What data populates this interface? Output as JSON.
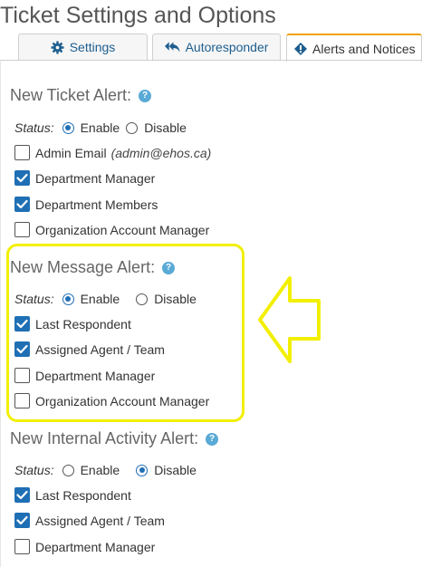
{
  "page_title": "Ticket Settings and Options",
  "colors": {
    "accent": "#1f6fb5",
    "highlight": "#f2ef00",
    "tab_active": "#f0a200"
  },
  "tabs": [
    {
      "label": "Settings",
      "icon": "gear-icon"
    },
    {
      "label": "Autoresponder",
      "icon": "reply-all-icon"
    },
    {
      "label": "Alerts and Notices",
      "icon": "alert-icon",
      "active": true
    }
  ],
  "status_label": "Status:",
  "enable_label": "Enable",
  "disable_label": "Disable",
  "sections": {
    "new_ticket": {
      "title": "New Ticket Alert:",
      "status": "enable",
      "options": [
        {
          "label": "Admin Email",
          "note": "(admin@ehos.ca)",
          "checked": false
        },
        {
          "label": "Department Manager",
          "checked": true
        },
        {
          "label": "Department Members",
          "checked": true
        },
        {
          "label": "Organization Account Manager",
          "checked": false
        }
      ]
    },
    "new_message": {
      "title": "New Message Alert:",
      "status": "enable",
      "options": [
        {
          "label": "Last Respondent",
          "checked": true
        },
        {
          "label": "Assigned Agent / Team",
          "checked": true
        },
        {
          "label": "Department Manager",
          "checked": false
        },
        {
          "label": "Organization Account Manager",
          "checked": false
        }
      ]
    },
    "new_internal_activity": {
      "title": "New Internal Activity Alert:",
      "status": "disable",
      "options": [
        {
          "label": "Last Respondent",
          "checked": true
        },
        {
          "label": "Assigned Agent / Team",
          "checked": true
        },
        {
          "label": "Department Manager",
          "checked": false
        }
      ]
    }
  }
}
